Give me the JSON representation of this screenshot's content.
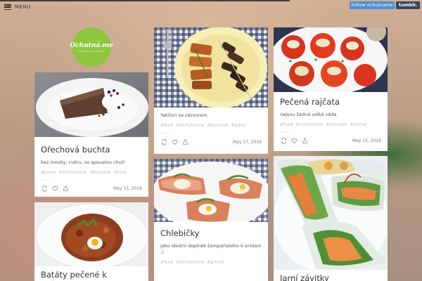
{
  "header": {
    "menu_label": "MENU",
    "follow_label": "Follow ochutname",
    "tumblr_label": "tumblr."
  },
  "logo": {
    "text": "Ochutná.me",
    "tagline": "Food blog z naší kuchyně"
  },
  "posts": [
    {
      "title": "Ořechová buchta",
      "caption": "bez mouky, cukru, se spoustou chutí",
      "tags": [
        "#paleo",
        "#Ochutname",
        "#bonzavk",
        "#food"
      ],
      "date": "May 15, 2016"
    },
    {
      "title": "Batáty pečené k kuřetem a",
      "caption": "",
      "tags": [],
      "date": ""
    },
    {
      "title": "",
      "caption": "Yakitori se zázvorem",
      "tags": [
        "#food",
        "#Ochutname",
        "#bonzavk",
        "#paleo"
      ],
      "date": "May 17, 2016"
    },
    {
      "title": "Chlebíčky",
      "caption": "jako ideální doplněk šampaňského k snídani :)",
      "tags": [
        "#food",
        "#Ochutname",
        "#primal"
      ],
      "date": ""
    },
    {
      "title": "Pečená rajčata",
      "caption": "nejsou žádná velká věda",
      "tags": [
        "#food",
        "#ochutname",
        "#bonzavk",
        "#primal"
      ],
      "date": "May 15, 2016"
    },
    {
      "title": "Jarní závitky",
      "caption": "",
      "tags": [],
      "date": ""
    }
  ]
}
